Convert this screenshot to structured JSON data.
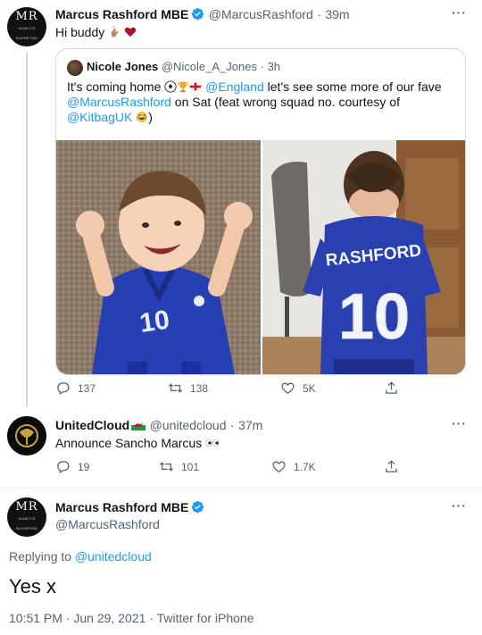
{
  "tweet1": {
    "name": "Marcus Rashford MBE",
    "handle": "@MarcusRashford",
    "dot": "·",
    "time": "39m",
    "text": "Hi buddy",
    "more": "···"
  },
  "quote": {
    "name": "Nicole Jones",
    "handle": "@Nicole_A_Jones",
    "dot": "·",
    "time": "3h",
    "text_part1": "It's coming home",
    "mention1": "@England",
    "text_part2": " let's see some more of our fave",
    "mention2": "@MarcusRashford",
    "text_part3": " on Sat (feat wrong squad no. courtesy of ",
    "mention3": "@KitbagUK",
    "text_part4": ")",
    "photo2_name": "RASHFORD",
    "photo2_number": "10",
    "photo1_number": "10"
  },
  "tweet1_actions": {
    "replies": "137",
    "retweets": "138",
    "likes": "5K"
  },
  "tweet2": {
    "name": "UnitedCloud",
    "handle": "@unitedcloud",
    "dot": "·",
    "time": "37m",
    "text": "Announce Sancho Marcus",
    "more": "···"
  },
  "tweet2_actions": {
    "replies": "19",
    "retweets": "101",
    "likes": "1.7K"
  },
  "main": {
    "name": "Marcus Rashford MBE",
    "handle": "@MarcusRashford",
    "more": "···",
    "replying_label": "Replying to",
    "replying_handle": "@unitedcloud",
    "text": "Yes x",
    "time": "10:51 PM",
    "dot1": "·",
    "date": "Jun 29, 2021",
    "dot2": "·",
    "source": "Twitter for iPhone"
  },
  "avatar_mono": "MR",
  "colors": {
    "accent": "#1d9bf0",
    "muted": "#536471",
    "text": "#0f1419",
    "border": "#cfd9de"
  }
}
